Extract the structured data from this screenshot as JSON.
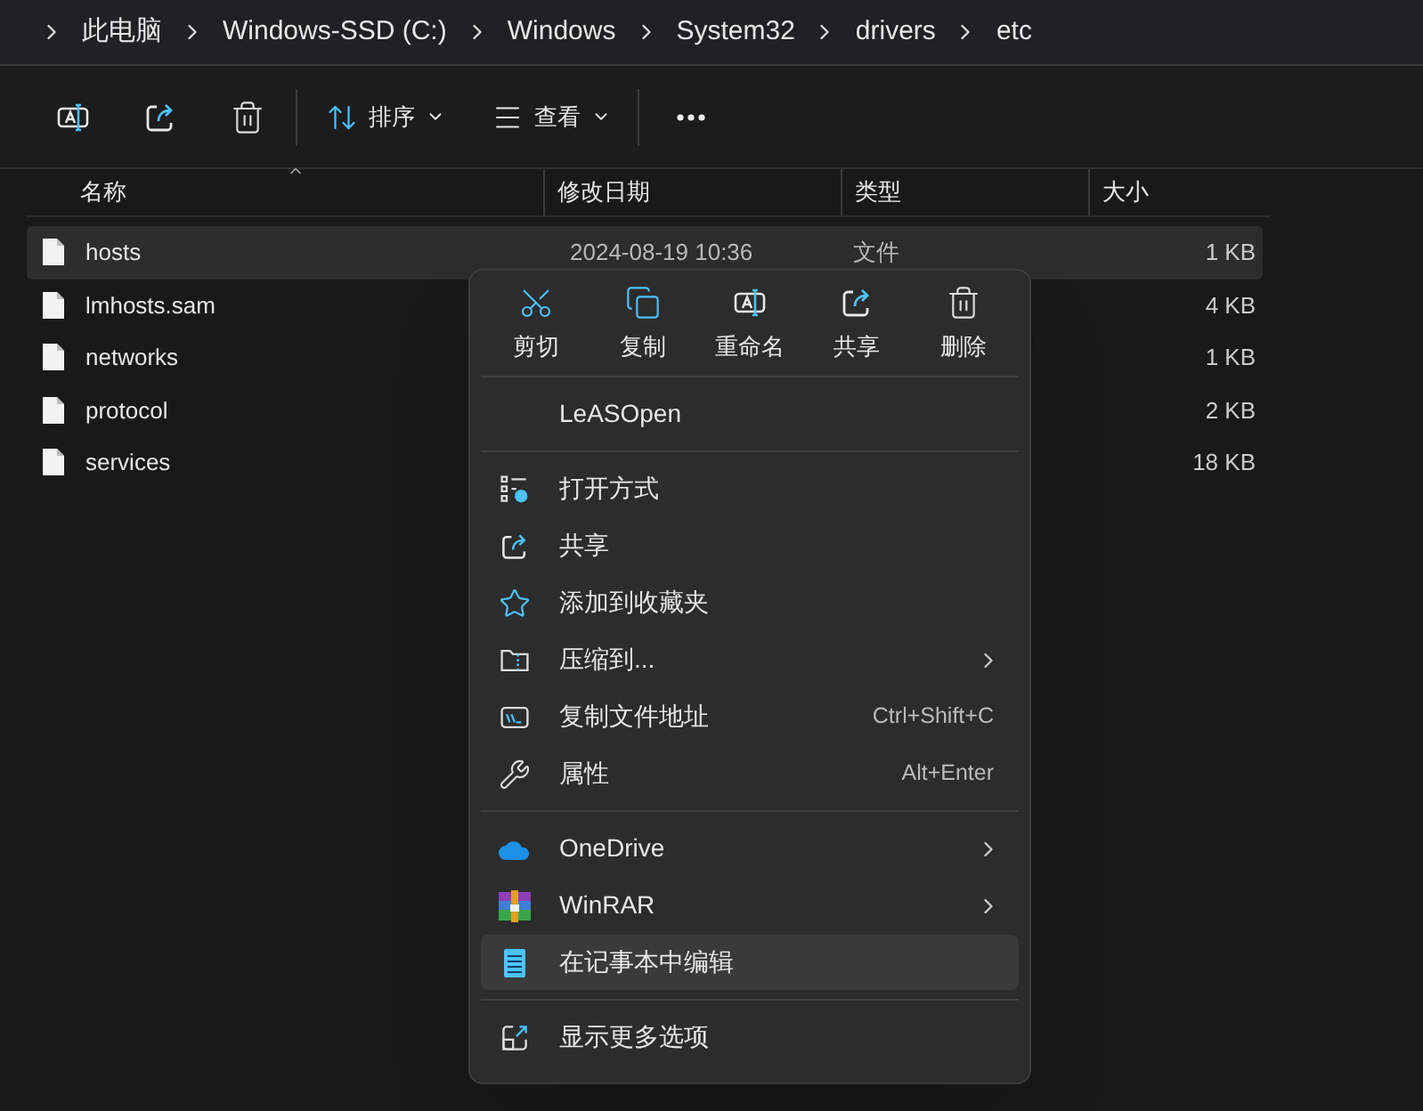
{
  "breadcrumb": [
    "此电脑",
    "Windows-SSD (C:)",
    "Windows",
    "System32",
    "drivers",
    "etc"
  ],
  "toolbar": {
    "sort": "排序",
    "view": "查看"
  },
  "columns": [
    {
      "label": "名称",
      "sorted": true
    },
    {
      "label": "修改日期",
      "sorted": false
    },
    {
      "label": "类型",
      "sorted": false
    },
    {
      "label": "大小",
      "sorted": false
    }
  ],
  "files": [
    {
      "name": "hosts",
      "date": "2024-08-19 10:36",
      "type": "文件",
      "size": "1 KB",
      "selected": true
    },
    {
      "name": "lmhosts.sam",
      "size": "4 KB",
      "selected": false
    },
    {
      "name": "networks",
      "size": "1 KB",
      "selected": false
    },
    {
      "name": "protocol",
      "size": "2 KB",
      "selected": false
    },
    {
      "name": "services",
      "size": "18 KB",
      "selected": false
    }
  ],
  "context_menu": {
    "actions": [
      "剪切",
      "复制",
      "重命名",
      "共享",
      "删除"
    ],
    "groups": [
      [
        {
          "label": "LeASOpen",
          "has_submenu": false,
          "selected": false
        }
      ],
      [
        {
          "label": "打开方式",
          "has_submenu": false,
          "selected": false
        },
        {
          "label": "共享",
          "has_submenu": false,
          "selected": false
        },
        {
          "label": "添加到收藏夹",
          "has_submenu": false,
          "selected": false
        },
        {
          "label": "压缩到...",
          "has_submenu": true,
          "selected": false
        },
        {
          "label": "复制文件地址",
          "shortcut": "Ctrl+Shift+C",
          "has_submenu": false,
          "selected": false
        },
        {
          "label": "属性",
          "shortcut": "Alt+Enter",
          "has_submenu": false,
          "selected": false
        }
      ],
      [
        {
          "label": "OneDrive",
          "has_submenu": true,
          "selected": false
        },
        {
          "label": "WinRAR",
          "has_submenu": true,
          "selected": false
        },
        {
          "label": "在记事本中编辑",
          "has_submenu": false,
          "selected": true
        }
      ],
      [
        {
          "label": "显示更多选项",
          "has_submenu": false,
          "selected": false
        }
      ]
    ]
  }
}
